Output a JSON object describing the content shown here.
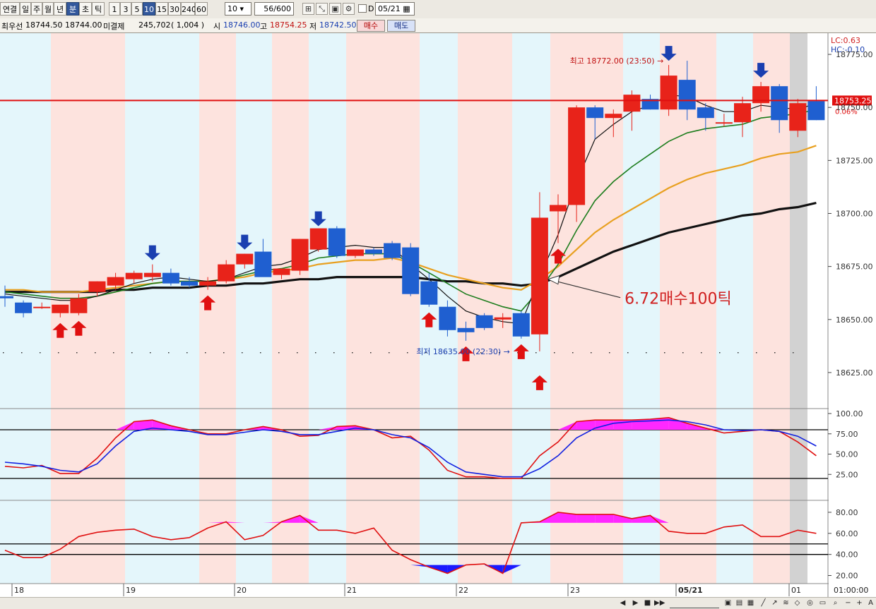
{
  "toolbar": {
    "items": [
      {
        "label": "연결",
        "active": false
      },
      {
        "label": "일",
        "active": false
      },
      {
        "label": "주",
        "active": false
      },
      {
        "label": "월",
        "active": false
      },
      {
        "label": "년",
        "active": false
      },
      {
        "label": "분",
        "active": true
      },
      {
        "label": "초",
        "active": false
      },
      {
        "label": "틱",
        "active": false
      },
      {
        "label": "1",
        "active": false
      },
      {
        "label": "3",
        "active": false
      },
      {
        "label": "5",
        "active": false
      },
      {
        "label": "10",
        "active": true
      },
      {
        "label": "15",
        "active": false
      },
      {
        "label": "30",
        "active": false
      },
      {
        "label": "240",
        "active": false
      },
      {
        "label": "60",
        "active": false
      }
    ],
    "interval_value": "10",
    "count_value": "56/600",
    "date_checkbox_label": "D",
    "date_value": "05/21"
  },
  "info": {
    "name": "최우선",
    "best_ask": "18744.50",
    "best_bid": "18744.00",
    "open_interest_label": "미결제",
    "open_interest": "245,702",
    "oi_change": "( 1,004 )",
    "open_label": "시",
    "open_value": "18746.00",
    "high_label": "고",
    "high_value": "18754.25",
    "low_label": "저",
    "low_value": "18742.50",
    "buy_label": "매수",
    "sell_label": "매도"
  },
  "chart_data": [
    {
      "type": "candlestick",
      "y_ticks": [
        "18775.00",
        "18750.00",
        "18725.00",
        "18700.00",
        "18675.00",
        "18650.00",
        "18625.00"
      ],
      "ylim": [
        18608,
        18785
      ],
      "current_price": "18753.25",
      "lc_label": "LC:0.63",
      "hc_label": "HC:-0.10",
      "pct_label": "0.06%",
      "high_annotation": "최고 18772.00 (23:50)",
      "low_annotation": "최저 18635.00 (22:30)",
      "note_text": "6.72매수100틱",
      "ohlc": [
        [
          18661,
          18666,
          18656,
          18660
        ],
        [
          18658,
          18659,
          18651,
          18653
        ],
        [
          18656,
          18658,
          18655,
          18656
        ],
        [
          18653,
          18656,
          18651,
          18657
        ],
        [
          18653,
          18662,
          18652,
          18660
        ],
        [
          18663,
          18668,
          18661,
          18668
        ],
        [
          18666,
          18672,
          18664,
          18670
        ],
        [
          18669,
          18673,
          18667,
          18672
        ],
        [
          18670,
          18676,
          18668,
          18672
        ],
        [
          18672,
          18674,
          18666,
          18667
        ],
        [
          18668,
          18670,
          18665,
          18666
        ],
        [
          18666,
          18670,
          18664,
          18668
        ],
        [
          18668,
          18678,
          18667,
          18676
        ],
        [
          18676,
          18681,
          18674,
          18681
        ],
        [
          18682,
          18688,
          18672,
          18670
        ],
        [
          18671,
          18674,
          18669,
          18674
        ],
        [
          18673,
          18688,
          18671,
          18688
        ],
        [
          18683,
          18692,
          18682,
          18693
        ],
        [
          18693,
          18694,
          18679,
          18680
        ],
        [
          18680,
          18683,
          18679,
          18683
        ],
        [
          18683,
          18684,
          18680,
          18681
        ],
        [
          18686,
          18687,
          18678,
          18679
        ],
        [
          18684,
          18686,
          18661,
          18662
        ],
        [
          18668,
          18672,
          18656,
          18657
        ],
        [
          18656,
          18659,
          18642,
          18645
        ],
        [
          18646,
          18649,
          18640,
          18644
        ],
        [
          18652,
          18653,
          18645,
          18646
        ],
        [
          18650,
          18653,
          18646,
          18651
        ],
        [
          18653,
          18654,
          18641,
          18642
        ],
        [
          18643,
          18710,
          18635,
          18698
        ],
        [
          18701,
          18709,
          18686,
          18704
        ],
        [
          18704,
          18751,
          18696,
          18750
        ],
        [
          18750,
          18751,
          18735,
          18745
        ],
        [
          18745,
          18749,
          18736,
          18747
        ],
        [
          18748,
          18758,
          18739,
          18756
        ],
        [
          18754,
          18756,
          18749,
          18749
        ],
        [
          18749,
          18770,
          18746,
          18765
        ],
        [
          18763,
          18772,
          18744,
          18749
        ],
        [
          18750,
          18752,
          18739,
          18745
        ],
        [
          18743,
          18747,
          18741,
          18743
        ],
        [
          18743,
          18755,
          18736,
          18752
        ],
        [
          18752,
          18762,
          18748,
          18760
        ],
        [
          18760,
          18761,
          18738,
          18744
        ],
        [
          18739,
          18754,
          18736,
          18752
        ],
        [
          18753,
          18760,
          18744,
          18744
        ]
      ],
      "ma_fast": [
        18662,
        18661,
        18660,
        18659,
        18659,
        18661,
        18664,
        18667,
        18669,
        18670,
        18669,
        18668,
        18669,
        18672,
        18675,
        18676,
        18679,
        18683,
        18684,
        18685,
        18684,
        18684,
        18676,
        18669,
        18661,
        18654,
        18651,
        18649,
        18648,
        18670,
        18690,
        18715,
        18735,
        18742,
        18748,
        18751,
        18756,
        18755,
        18751,
        18748,
        18748,
        18751,
        18750,
        18749,
        18752
      ],
      "ma_green": [
        18663,
        18662,
        18661,
        18660,
        18660,
        18661,
        18663,
        18665,
        18667,
        18668,
        18668,
        18668,
        18669,
        18671,
        18673,
        18674,
        18676,
        18679,
        18680,
        18681,
        18681,
        18681,
        18677,
        18672,
        18667,
        18662,
        18659,
        18656,
        18654,
        18664,
        18676,
        18692,
        18706,
        18715,
        18722,
        18728,
        18734,
        18738,
        18740,
        18741,
        18742,
        18745,
        18746,
        18747,
        18749
      ],
      "ma_orange": [
        18664,
        18664,
        18663,
        18663,
        18663,
        18664,
        18665,
        18666,
        18667,
        18668,
        18668,
        18668,
        18669,
        18670,
        18672,
        18673,
        18674,
        18676,
        18677,
        18678,
        18678,
        18679,
        18677,
        18674,
        18671,
        18669,
        18667,
        18665,
        18664,
        18669,
        18675,
        18683,
        18691,
        18697,
        18702,
        18707,
        18712,
        18716,
        18719,
        18721,
        18723,
        18726,
        18728,
        18729,
        18732
      ],
      "ma_black": [
        18663,
        18663,
        18663,
        18663,
        18663,
        18663,
        18664,
        18664,
        18665,
        18665,
        18665,
        18666,
        18666,
        18667,
        18667,
        18668,
        18669,
        18669,
        18670,
        18670,
        18670,
        18670,
        18670,
        18669,
        18668,
        18668,
        18667,
        18667,
        18666,
        18667,
        18670,
        18674,
        18678,
        18682,
        18685,
        18688,
        18691,
        18693,
        18695,
        18697,
        18699,
        18700,
        18702,
        18703,
        18705
      ],
      "buy_signal_candles": [
        3,
        4,
        11,
        23,
        25,
        28,
        30
      ],
      "sell_signal_candles": [
        8,
        13,
        17,
        36,
        41
      ],
      "bg_bands": "alternating pink / light blue session stripes"
    },
    {
      "type": "line",
      "y_ticks": [
        "100.00",
        "75.00",
        "50.00",
        "25.00"
      ],
      "ylim": [
        0,
        100
      ],
      "hlines": [
        80,
        20
      ],
      "series": [
        {
          "color": "#e01010",
          "values": [
            35,
            33,
            36,
            26,
            26,
            45,
            70,
            90,
            92,
            85,
            80,
            75,
            75,
            80,
            84,
            80,
            72,
            73,
            84,
            85,
            80,
            70,
            72,
            55,
            30,
            22,
            22,
            20,
            20,
            48,
            65,
            90,
            92,
            92,
            92,
            93,
            95,
            88,
            82,
            76,
            78,
            80,
            78,
            65,
            48
          ]
        },
        {
          "color": "#1020e0",
          "values": [
            40,
            38,
            35,
            30,
            28,
            38,
            60,
            78,
            82,
            80,
            78,
            74,
            74,
            77,
            80,
            78,
            74,
            74,
            78,
            82,
            80,
            74,
            70,
            58,
            40,
            28,
            25,
            22,
            22,
            32,
            48,
            70,
            82,
            88,
            90,
            91,
            92,
            90,
            86,
            80,
            79,
            80,
            78,
            72,
            60
          ]
        }
      ]
    },
    {
      "type": "line",
      "y_ticks": [
        "80.00",
        "60.00",
        "40.00",
        "20.00"
      ],
      "ylim": [
        15,
        88
      ],
      "hlines": [
        50,
        40
      ],
      "series": [
        {
          "color": "#e01010",
          "values": [
            44,
            37,
            37,
            45,
            57,
            61,
            63,
            64,
            57,
            54,
            56,
            65,
            71,
            54,
            58,
            71,
            77,
            63,
            63,
            60,
            65,
            44,
            35,
            28,
            22,
            30,
            31,
            22,
            70,
            71,
            80,
            78,
            78,
            78,
            74,
            77,
            62,
            60,
            60,
            66,
            68,
            57,
            57,
            63,
            60
          ]
        }
      ]
    }
  ],
  "x_labels": [
    "18",
    "19",
    "20",
    "21",
    "22",
    "23",
    "05/21",
    "01"
  ],
  "time_label": "01:00:00"
}
